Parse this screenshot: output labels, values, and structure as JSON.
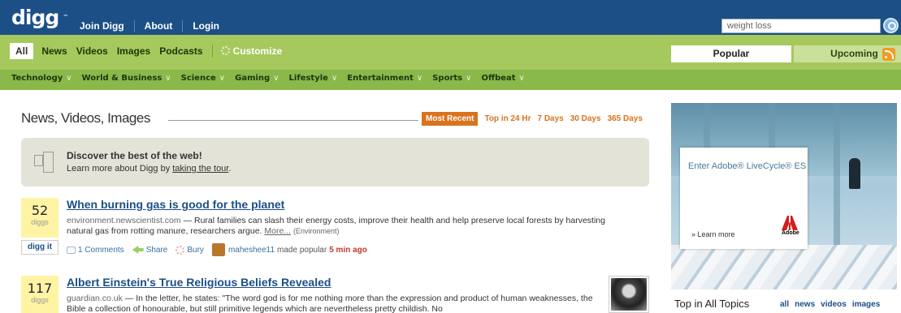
{
  "header": {
    "logo": "digg",
    "logo_tm": "™",
    "nav": [
      "Join Digg",
      "About",
      "Login"
    ],
    "search_value": "weight loss",
    "search_icon": "search-icon"
  },
  "categories": {
    "all": "All",
    "items": [
      "News",
      "Videos",
      "Images",
      "Podcasts"
    ],
    "customize": "Customize"
  },
  "tabs": {
    "popular": "Popular",
    "upcoming": "Upcoming",
    "rss_icon": "rss-icon"
  },
  "topics": [
    "Technology",
    "World & Business",
    "Science",
    "Gaming",
    "Lifestyle",
    "Entertainment",
    "Sports",
    "Offbeat"
  ],
  "main": {
    "title": "News, Videos, Images",
    "sort": {
      "active": "Most Recent",
      "options": [
        "Top in 24 Hr",
        "7 Days",
        "30 Days",
        "365 Days"
      ]
    },
    "discover": {
      "heading": "Discover the best of the web!",
      "text": "Learn more about Digg by ",
      "link": "taking the tour",
      "end": "."
    },
    "stories": [
      {
        "diggs": "52",
        "diggs_label": "diggs",
        "digg_it": "digg it",
        "title": "When burning gas is good for the planet",
        "source": "environment.newscientist.com",
        "text": " — Rural families can slash their energy costs, improve their health and help preserve local forests by harvesting natural gas from rotting manure, researchers argue.",
        "more": "More...",
        "topic": "(Environment)",
        "comments": "1 Comments",
        "share": "Share",
        "bury": "Bury",
        "user": "maheshee11",
        "made_popular": "made popular",
        "time": "5 min ago"
      },
      {
        "diggs": "117",
        "diggs_label": "diggs",
        "title": "Albert Einstein's True Religious Beliefs Revealed",
        "source": "guardian.co.uk",
        "text": " — In the letter, he states: \"The word god is for me nothing more than the expression and product of human weaknesses, the Bible a collection of honourable, but still primitive legends which are nevertheless pretty childish. No"
      }
    ]
  },
  "ad": {
    "enter": "Enter Adobe® LiveCycle® ES",
    "learn": "» Learn more",
    "brand": "Adobe"
  },
  "sidebar": {
    "top_title": "Top in All Topics",
    "filters": [
      "all",
      "news",
      "videos",
      "images"
    ]
  }
}
